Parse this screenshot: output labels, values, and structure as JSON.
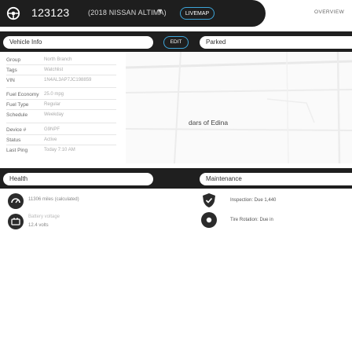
{
  "topbar": {
    "vehicle_id": "123123",
    "vehicle_model": "(2018 NISSAN ALTIMA)",
    "livemap_label": "LIVEMAP",
    "overview_label": "OVERVIEW"
  },
  "vehicle_info": {
    "title": "Vehicle Info",
    "edit_label": "EDIT",
    "parked_label": "Parked",
    "rows": {
      "group": {
        "label": "Group",
        "value": "North Branch"
      },
      "tags": {
        "label": "Tags",
        "value": "Watchlist"
      },
      "vin": {
        "label": "VIN",
        "value": "1N4AL3AP7JC198859"
      },
      "fuel_economy": {
        "label": "Fuel Economy",
        "value": "25.0 mpg"
      },
      "fuel_type": {
        "label": "Fuel Type",
        "value": "Regular"
      },
      "schedule": {
        "label": "Schedule",
        "value": "Weekday"
      },
      "device": {
        "label": "Device #",
        "value": "G9NPF"
      },
      "status": {
        "label": "Status",
        "value": "Active"
      },
      "last_ping": {
        "label": "Last Ping",
        "value": "Today 7:10 AM"
      }
    },
    "map_label": "dars of Edina"
  },
  "health": {
    "title": "Health",
    "odometer": "11306 miles (calculated)",
    "battery_label": "Battery voltage",
    "battery_value": "12.4 volts",
    "maintenance_title": "Maintenance",
    "inspection": "Inspection: Due 1,440",
    "tire_rotation": "Tire Rotation: Due in"
  }
}
